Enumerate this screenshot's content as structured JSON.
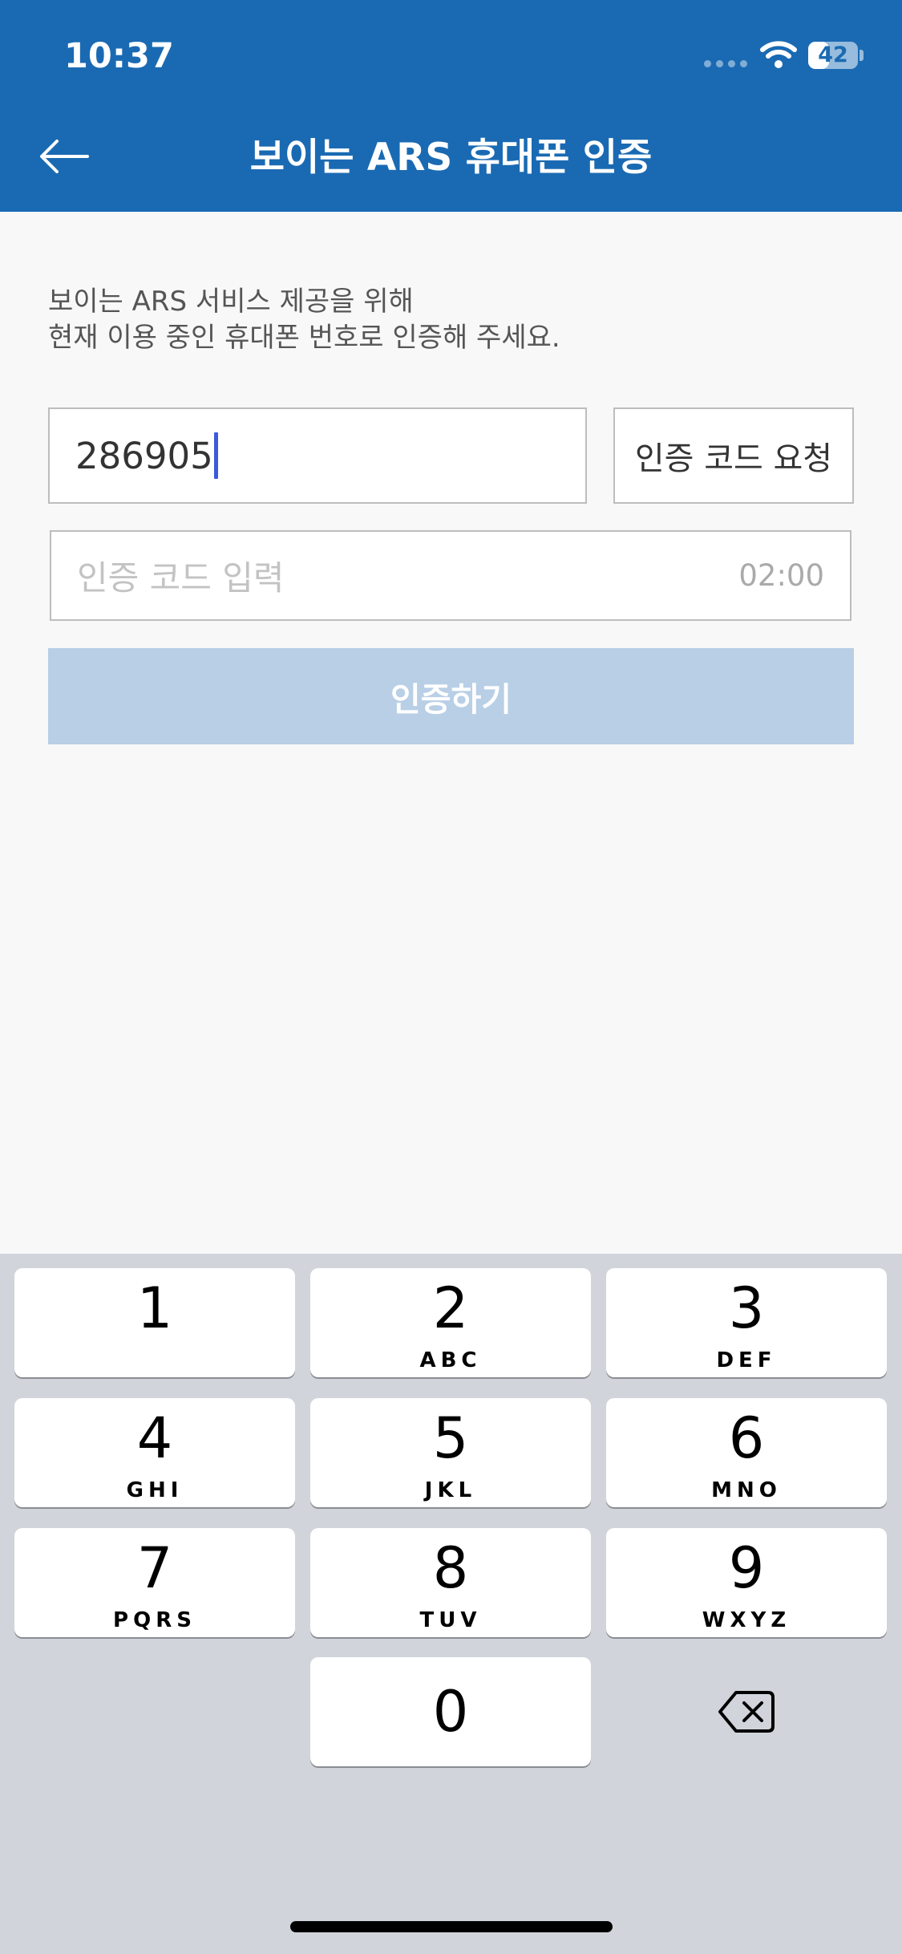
{
  "status_bar": {
    "time": "10:37",
    "battery": "42",
    "battery_level_percent": 42
  },
  "header": {
    "title": "보이는 ARS 휴대폰 인증",
    "back_icon": "arrow-left-icon"
  },
  "instructions": {
    "line1": "보이는 ARS 서비스 제공을 위해",
    "line2": "현재 이용 중인 휴대폰 번호로 인증해 주세요."
  },
  "phone_field": {
    "value": "286905"
  },
  "request_button": {
    "label": "인증 코드 요청"
  },
  "code_field": {
    "placeholder": "인증 코드 입력",
    "timer": "02:00"
  },
  "verify_button": {
    "label": "인증하기"
  },
  "keypad": {
    "keys": [
      {
        "digit": "1",
        "letters": ""
      },
      {
        "digit": "2",
        "letters": "ABC"
      },
      {
        "digit": "3",
        "letters": "DEF"
      },
      {
        "digit": "4",
        "letters": "GHI"
      },
      {
        "digit": "5",
        "letters": "JKL"
      },
      {
        "digit": "6",
        "letters": "MNO"
      },
      {
        "digit": "7",
        "letters": "PQRS"
      },
      {
        "digit": "8",
        "letters": "TUV"
      },
      {
        "digit": "9",
        "letters": "WXYZ"
      },
      {
        "digit": "0",
        "letters": ""
      }
    ],
    "delete_icon": "backspace-icon"
  },
  "colors": {
    "header_bg": "#1a6ab3",
    "verify_disabled_bg": "#b8cfe6",
    "caret": "#3b5bdb",
    "keyboard_bg": "#d1d4da"
  }
}
